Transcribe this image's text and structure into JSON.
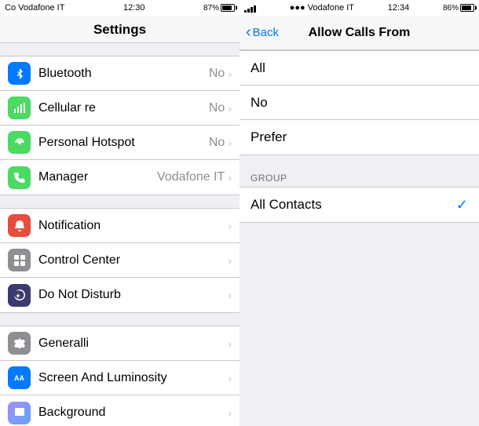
{
  "left_status": {
    "carrier": "Co Vodafone IT",
    "time": "12:30",
    "signal_pct": 87,
    "battery_label": "87%"
  },
  "right_status": {
    "dots": "●●●",
    "carrier": "Vodafone IT",
    "time": "12:34",
    "battery_label": "86%"
  },
  "left_panel": {
    "header": "Settings",
    "groups": [
      {
        "items": [
          {
            "icon": "bluetooth",
            "icon_bg": "icon-blue",
            "icon_char": "B",
            "label": "Bluetooth",
            "value": "No",
            "has_chevron": true
          },
          {
            "icon": "cellular",
            "icon_bg": "icon-green-cellular",
            "icon_char": "📶",
            "label": "Cellular re",
            "value": "No",
            "has_chevron": true
          },
          {
            "icon": "hotspot",
            "icon_bg": "icon-green-hotspot",
            "icon_char": "🔗",
            "label": "Personal Hotspot",
            "value": "No",
            "has_chevron": true
          },
          {
            "icon": "phone",
            "icon_bg": "icon-phone",
            "icon_char": "📞",
            "label": "Manager",
            "value": "Vodafone IT",
            "has_chevron": true
          }
        ]
      },
      {
        "items": [
          {
            "icon": "notifications",
            "icon_bg": "icon-red",
            "icon_char": "🔔",
            "label": "Notification",
            "value": "",
            "has_chevron": true
          },
          {
            "icon": "control-center",
            "icon_bg": "icon-gray",
            "icon_char": "⊞",
            "label": "Control Center",
            "value": "",
            "has_chevron": true
          },
          {
            "icon": "do-not-disturb",
            "icon_bg": "icon-dark",
            "icon_char": "🌙",
            "label": "Do Not Disturb",
            "value": "",
            "has_chevron": true
          }
        ]
      },
      {
        "items": [
          {
            "icon": "general",
            "icon_bg": "icon-gear",
            "icon_char": "⚙",
            "label": "Generalli",
            "value": "",
            "has_chevron": true
          },
          {
            "icon": "display",
            "icon_bg": "icon-aa",
            "icon_char": "AA",
            "label": "Screen And Luminosity",
            "value": "",
            "has_chevron": true
          },
          {
            "icon": "wallpaper",
            "icon_bg": "icon-purple",
            "icon_char": "🖼",
            "label": "Background",
            "value": "",
            "has_chevron": true
          }
        ]
      }
    ]
  },
  "right_panel": {
    "back_label": "Back",
    "title": "Allow Calls From",
    "options": [
      {
        "label": "All",
        "selected": false
      },
      {
        "label": "No",
        "selected": false
      },
      {
        "label": "Prefer",
        "selected": false
      }
    ],
    "group_header": "GROUP",
    "group_items": [
      {
        "label": "All Contacts",
        "selected": true
      }
    ]
  }
}
